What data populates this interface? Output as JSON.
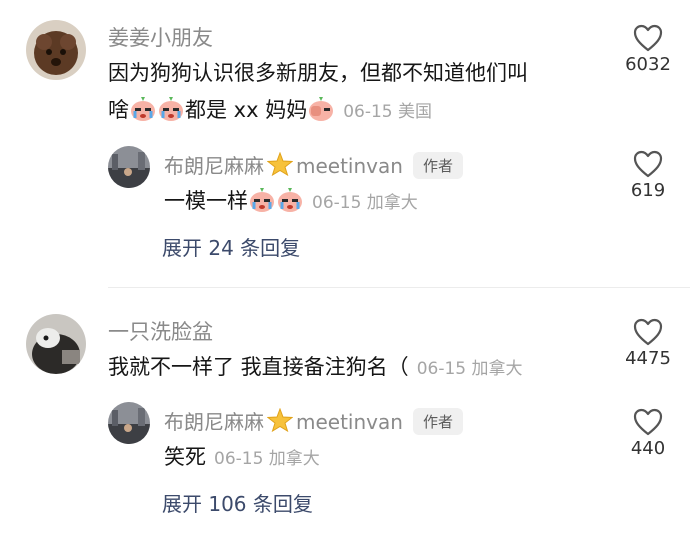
{
  "comments": [
    {
      "username": "姜姜小朋友",
      "text_line1": "因为狗狗认识很多新朋友，但都不知道他们叫",
      "text_line2_a": "啥",
      "text_line2_b": "都是 xx 妈妈",
      "meta": "06-15 美国",
      "likes": "6032",
      "reply": {
        "username": "布朗尼麻麻",
        "username_suffix": "meetinvan",
        "badge": "作者",
        "text": "一模一样",
        "meta": "06-15 加拿大",
        "likes": "619"
      },
      "expand_label": "展开 24 条回复"
    },
    {
      "username": "一只洗脸盆",
      "text": "我就不一样了 我直接备注狗名（",
      "meta": "06-15 加拿大",
      "likes": "4475",
      "reply": {
        "username": "布朗尼麻麻",
        "username_suffix": "meetinvan",
        "badge": "作者",
        "text": "笑死",
        "meta": "06-15 加拿大",
        "likes": "440"
      },
      "expand_label": "展开 106 条回复"
    }
  ],
  "icons": {
    "like": "heart-outline-icon",
    "crying": "crying-peach-emoji",
    "star": "sparkle-star-emoji"
  },
  "colors": {
    "username": "#8a8a8a",
    "text": "#161616",
    "meta": "#a5a5a5",
    "link": "#3c4a6b"
  }
}
